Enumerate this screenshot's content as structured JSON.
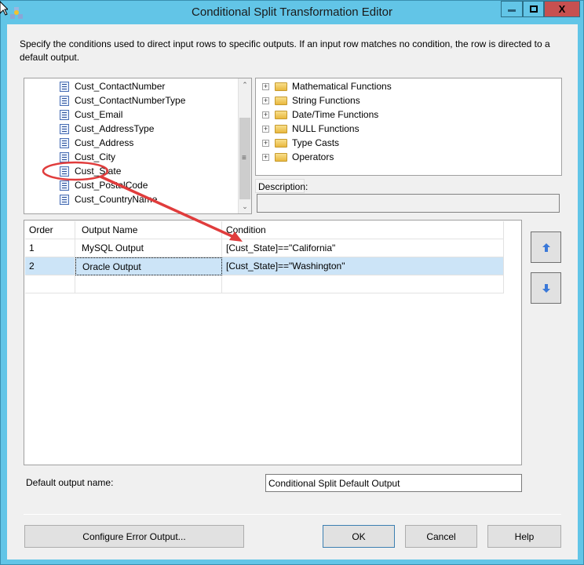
{
  "window": {
    "title": "Conditional Split Transformation Editor",
    "controls": {
      "minimize": "minimize",
      "maximize": "maximize",
      "close": "close"
    }
  },
  "intro_text": "Specify the conditions used to direct input rows to specific outputs. If an input row matches no condition, the row is directed to a default output.",
  "columns_tree": {
    "items": [
      {
        "label": "Cust_ContactNumber"
      },
      {
        "label": "Cust_ContactNumberType"
      },
      {
        "label": "Cust_Email"
      },
      {
        "label": "Cust_AddressType"
      },
      {
        "label": "Cust_Address"
      },
      {
        "label": "Cust_City"
      },
      {
        "label": "Cust_State"
      },
      {
        "label": "Cust_PostalCode"
      },
      {
        "label": "Cust_CountryName"
      }
    ],
    "highlighted": "Cust_State"
  },
  "functions_tree": {
    "items": [
      {
        "label": "Mathematical Functions"
      },
      {
        "label": "String Functions"
      },
      {
        "label": "Date/Time Functions"
      },
      {
        "label": "NULL Functions"
      },
      {
        "label": "Type Casts"
      },
      {
        "label": "Operators"
      }
    ]
  },
  "description": {
    "label": "Description:",
    "value": ""
  },
  "conditions_grid": {
    "headers": {
      "order": "Order",
      "output_name": "Output Name",
      "condition": "Condition"
    },
    "rows": [
      {
        "order": "1",
        "output_name": "MySQL Output",
        "condition": "[Cust_State]==\"California\""
      },
      {
        "order": "2",
        "output_name": "Oracle Output",
        "condition": "[Cust_State]==\"Washington\"",
        "selected": true
      }
    ]
  },
  "side_buttons": {
    "up": "move-up",
    "down": "move-down"
  },
  "default_output": {
    "label": "Default output name:",
    "value": "Conditional Split Default Output"
  },
  "buttons": {
    "configure_error": "Configure Error Output...",
    "ok": "OK",
    "cancel": "Cancel",
    "help": "Help"
  },
  "colors": {
    "titlebar": "#62c5e7",
    "close_button": "#c75050",
    "selection": "#cce4f7",
    "annotation": "#e03c3c"
  }
}
